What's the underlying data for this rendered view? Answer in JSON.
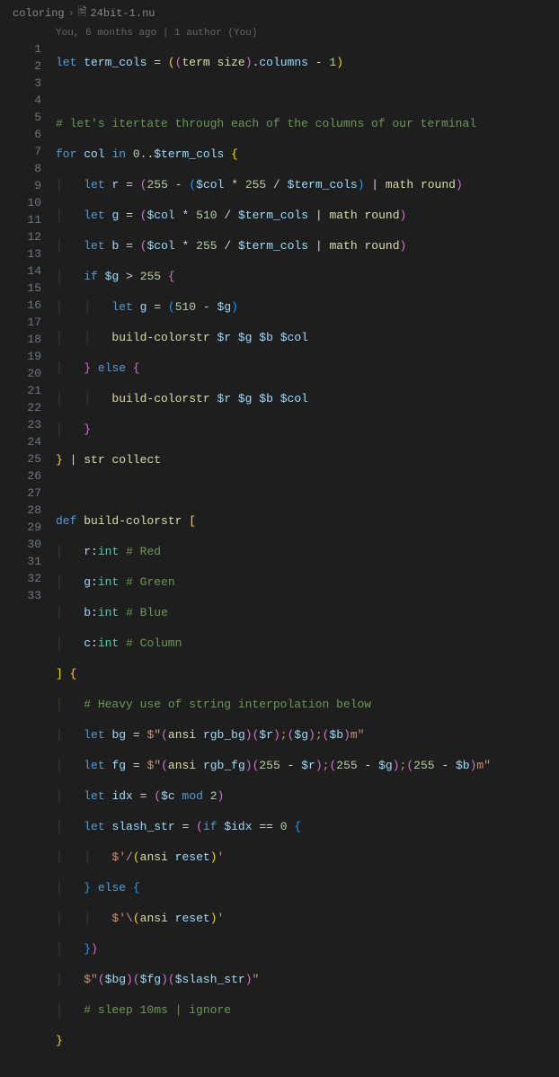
{
  "breadcrumb": {
    "folder": "coloring",
    "file": "24bit-1.nu"
  },
  "annotation": "You, 6 months ago | 1 author (You)",
  "lines": [
    "1",
    "2",
    "3",
    "4",
    "5",
    "6",
    "7",
    "8",
    "9",
    "10",
    "11",
    "12",
    "13",
    "14",
    "15",
    "16",
    "17",
    "18",
    "19",
    "20",
    "21",
    "22",
    "23",
    "24",
    "25",
    "26",
    "27",
    "28",
    "29",
    "30",
    "31",
    "32",
    "33"
  ],
  "code": {
    "l1": {
      "let": "let",
      "term_cols": "term_cols",
      "eq": "=",
      "term": "term",
      "size": "size",
      "columns": "columns",
      "minus": "-",
      "one": "1"
    },
    "l3": "# let's itertate through each of the columns of our terminal",
    "l4": {
      "for": "for",
      "col": "col",
      "in": "in",
      "zero": "0",
      "range": "..",
      "term_cols": "$term_cols"
    },
    "l5": {
      "let": "let",
      "r": "r",
      "eq": "=",
      "n255": "255",
      "minus": "-",
      "col": "$col",
      "times": "*",
      "div": "/",
      "term_cols": "$term_cols",
      "pipe": "|",
      "math": "math",
      "round": "round"
    },
    "l6": {
      "let": "let",
      "g": "g",
      "eq": "=",
      "col": "$col",
      "times": "*",
      "n510": "510",
      "div": "/",
      "term_cols": "$term_cols",
      "pipe": "|",
      "math": "math",
      "round": "round"
    },
    "l7": {
      "let": "let",
      "b": "b",
      "eq": "=",
      "col": "$col",
      "times": "*",
      "n255": "255",
      "div": "/",
      "term_cols": "$term_cols",
      "pipe": "|",
      "math": "math",
      "round": "round"
    },
    "l8": {
      "if": "if",
      "g": "$g",
      "gt": ">",
      "n255": "255"
    },
    "l9": {
      "let": "let",
      "g": "g",
      "eq": "=",
      "n510": "510",
      "minus": "-",
      "gv": "$g"
    },
    "l10": {
      "fn": "build-colorstr",
      "r": "$r",
      "g": "$g",
      "b": "$b",
      "col": "$col"
    },
    "l11": {
      "else": "else"
    },
    "l12": {
      "fn": "build-colorstr",
      "r": "$r",
      "g": "$g",
      "b": "$b",
      "col": "$col"
    },
    "l14": {
      "pipe": "|",
      "str": "str",
      "collect": "collect"
    },
    "l16": {
      "def": "def",
      "fn": "build-colorstr"
    },
    "l17": {
      "p": "r",
      "t": "int",
      "c": "# Red"
    },
    "l18": {
      "p": "g",
      "t": "int",
      "c": "# Green"
    },
    "l19": {
      "p": "b",
      "t": "int",
      "c": "# Blue"
    },
    "l20": {
      "p": "c",
      "t": "int",
      "c": "# Column"
    },
    "l22": "# Heavy use of string interpolation below",
    "l23": {
      "let": "let",
      "bg": "bg",
      "eq": "=",
      "s1": "$\"",
      "ansi": "ansi",
      "rgb_bg": "rgb_bg",
      "r": "$r",
      "g": "$g",
      "b": "$b",
      "semi": ";",
      "m": "m\""
    },
    "l24": {
      "let": "let",
      "fg": "fg",
      "eq": "=",
      "s1": "$\"",
      "ansi": "ansi",
      "rgb_fg": "rgb_fg",
      "n255": "255",
      "minus": "-",
      "r": "$r",
      "g": "$g",
      "b": "$b",
      "semi": ";",
      "m": "m\""
    },
    "l25": {
      "let": "let",
      "idx": "idx",
      "eq": "=",
      "c": "$c",
      "mod": "mod",
      "two": "2"
    },
    "l26": {
      "let": "let",
      "slash_str": "slash_str",
      "eq": "=",
      "if": "if",
      "idx": "$idx",
      "eqeq": "==",
      "zero": "0"
    },
    "l27": {
      "s": "$'/",
      "ansi": "ansi",
      "reset": "reset",
      "e": "'"
    },
    "l28": {
      "else": "else"
    },
    "l29": {
      "s": "$'\\",
      "ansi": "ansi",
      "reset": "reset",
      "e": "'"
    },
    "l31": {
      "s1": "$\"",
      "bg": "$bg",
      "fg": "$fg",
      "slash_str": "$slash_str",
      "s2": "\""
    },
    "l32": "# sleep 10ms | ignore"
  }
}
